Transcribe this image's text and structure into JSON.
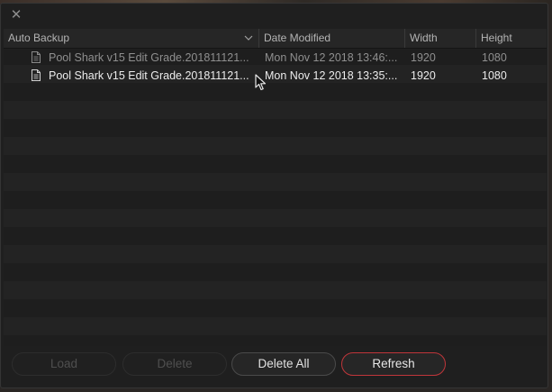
{
  "dialog": {
    "close_glyph": "✕"
  },
  "table": {
    "columns": {
      "name": "Auto Backup",
      "date": "Date Modified",
      "width": "Width",
      "height": "Height"
    },
    "sort_icon": "chevron-down-icon",
    "rows": [
      {
        "name": "Pool Shark v15 Edit Grade.201811121...",
        "date": "Mon Nov 12 2018 13:46:...",
        "width": "1920",
        "height": "1080",
        "selected": false
      },
      {
        "name": "Pool Shark v15 Edit Grade.201811121...",
        "date": "Mon Nov 12 2018 13:35:...",
        "width": "1920",
        "height": "1080",
        "selected": true
      }
    ]
  },
  "buttons": {
    "load": "Load",
    "delete": "Delete",
    "delete_all": "Delete All",
    "refresh": "Refresh"
  },
  "colors": {
    "accent_border": "#c0363a",
    "background": "#1f1f1f"
  }
}
